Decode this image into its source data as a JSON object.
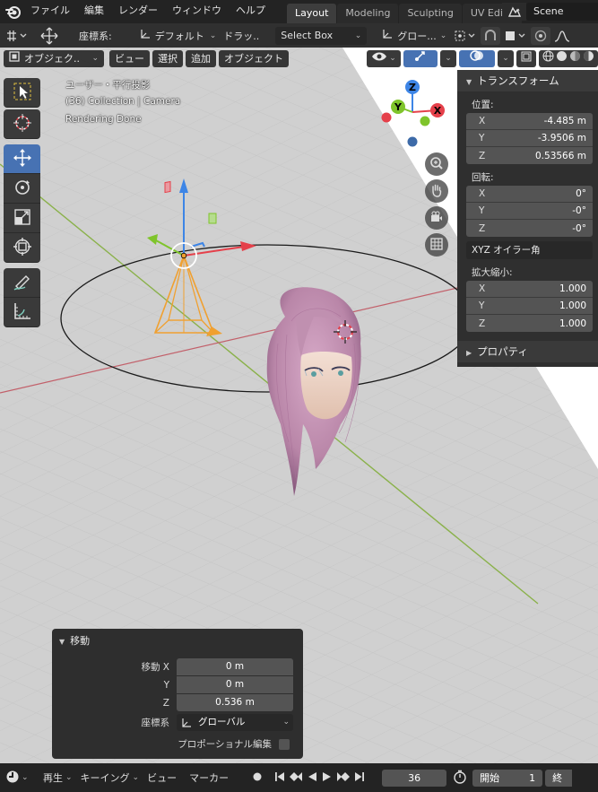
{
  "menu": {
    "items": [
      "ファイル",
      "編集",
      "レンダー",
      "ウィンドウ",
      "ヘルプ"
    ]
  },
  "workspaces": [
    "Layout",
    "Modeling",
    "Sculpting",
    "UV Editir"
  ],
  "scene": {
    "name": "Scene"
  },
  "tool_header": {
    "orientation_label": "座標系:",
    "orientation_value": "デフォルト",
    "drag_label": "ドラッ..",
    "drag_value": "Select Box",
    "transform_orientation": "グロー..."
  },
  "viewport_header": {
    "mode": "オブジェク..",
    "view": "ビュー",
    "select": "選択",
    "add": "追加",
    "object": "オブジェクト"
  },
  "viewport_info": {
    "line1": "ユーザー・平行投影",
    "line2": "(36) Collection | Camera",
    "line3": "Rendering Done"
  },
  "gizmo_axes": {
    "z": "Z",
    "y": "Y",
    "x": "X"
  },
  "transform_panel": {
    "title": "トランスフォーム",
    "location_label": "位置:",
    "location": [
      {
        "axis": "X",
        "value": "-4.485 m"
      },
      {
        "axis": "Y",
        "value": "-3.9506 m"
      },
      {
        "axis": "Z",
        "value": "0.53566 m"
      }
    ],
    "rotation_label": "回転:",
    "rotation": [
      {
        "axis": "X",
        "value": "0°"
      },
      {
        "axis": "Y",
        "value": "-0°"
      },
      {
        "axis": "Z",
        "value": "-0°"
      }
    ],
    "rotation_mode": "XYZ オイラー角",
    "scale_label": "拡大縮小:",
    "scale": [
      {
        "axis": "X",
        "value": "1.000"
      },
      {
        "axis": "Y",
        "value": "1.000"
      },
      {
        "axis": "Z",
        "value": "1.000"
      }
    ],
    "properties_title": "プロパティ"
  },
  "operator_panel": {
    "title": "移動",
    "move_x_label": "移動 X",
    "move_x": "0 m",
    "move_y_label": "Y",
    "move_y": "0 m",
    "move_z_label": "Z",
    "move_z": "0.536 m",
    "orientation_label": "座標系",
    "orientation_value": "グローバル",
    "proportional_label": "プロポーショナル編集"
  },
  "timeline": {
    "playback": "再生",
    "keying": "キーイング",
    "view": "ビュー",
    "marker": "マーカー",
    "current_frame": "36",
    "start_label": "開始",
    "start_value": "1",
    "end_label": "終"
  },
  "colors": {
    "accent": "#4772b3",
    "axis_x": "#e5404a",
    "axis_y": "#7fc42b",
    "axis_z": "#3d85e6",
    "camera": "#f0a030"
  }
}
